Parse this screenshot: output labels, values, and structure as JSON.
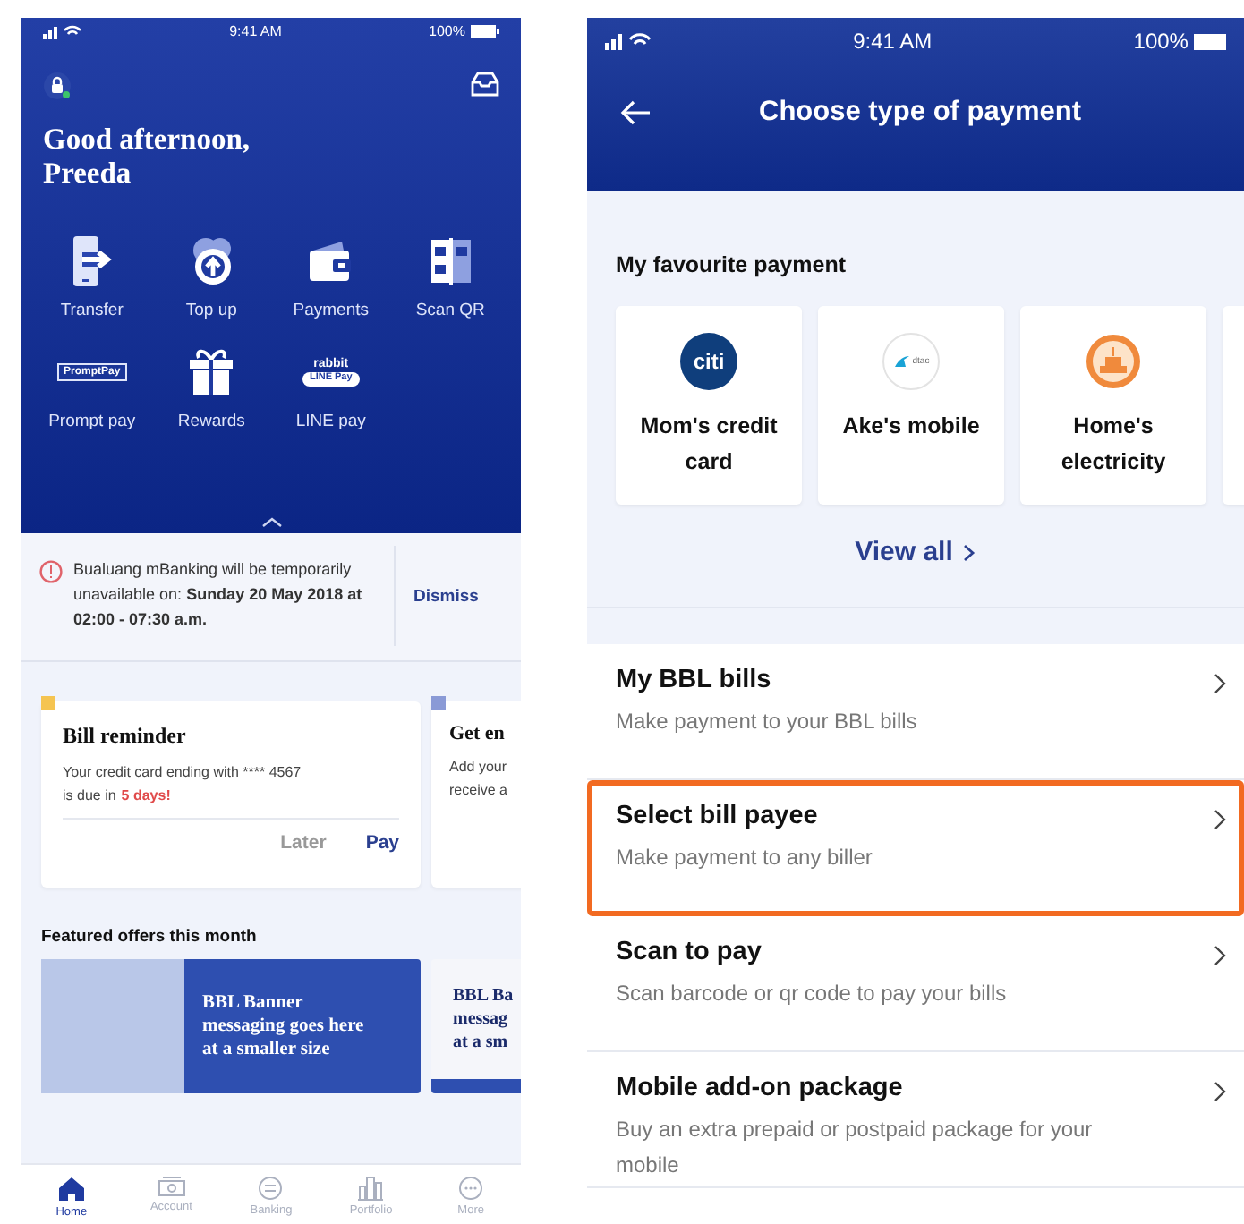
{
  "home_screen": {
    "status_bar": {
      "time": "9:41 AM",
      "battery": "100%"
    },
    "greeting": "Good afternoon, Preeda",
    "shortcuts": [
      {
        "kind": "transfer",
        "label": "Transfer"
      },
      {
        "kind": "topup",
        "label": "Top up"
      },
      {
        "kind": "payments",
        "label": "Payments"
      },
      {
        "kind": "scanqr",
        "label": "Scan QR"
      },
      {
        "kind": "promptpay",
        "label": "Prompt pay",
        "logo_lines": [
          "PromptPay"
        ]
      },
      {
        "kind": "rewards",
        "label": "Rewards"
      },
      {
        "kind": "linepay",
        "label": "LINE pay",
        "logo_lines": [
          "rabbit",
          "LINE Pay"
        ]
      }
    ],
    "notice": {
      "message": "Bualuang mBanking will be temporarily unavailable on: **Sunday 20 May 2018 at 02:00 - 07:30 a.m.**",
      "action": "Dismiss"
    },
    "cards": [
      {
        "color": "#f5c451",
        "title": "Bill reminder",
        "body": [
          "Your credit card ending with **** 4567",
          "is due in"
        ],
        "highlight": "5 days!",
        "actions": [
          {
            "label": "Later",
            "primary": false
          },
          {
            "label": "Pay",
            "primary": true
          }
        ]
      },
      {
        "color": "#8a9ad6",
        "title": "Get en",
        "body": [
          "Add your",
          "receive a"
        ]
      }
    ],
    "featured": {
      "title": "Featured offers this month",
      "banners": [
        {
          "kind": "photo",
          "lines": [
            "BBL Banner",
            "messaging goes here",
            "at a smaller size"
          ]
        },
        {
          "kind": "plain",
          "lines": [
            "BBL Ba",
            "messag",
            "at a sm"
          ]
        }
      ]
    },
    "tab_bar": [
      {
        "kind": "home",
        "label": "Home",
        "selected": true
      },
      {
        "kind": "account",
        "label": "Account",
        "selected": false
      },
      {
        "kind": "banking",
        "label": "Banking",
        "selected": false
      },
      {
        "kind": "portfolio",
        "label": "Portfolio",
        "selected": false
      },
      {
        "kind": "more",
        "label": "More",
        "selected": false
      }
    ]
  },
  "payment_screen": {
    "status_bar": {
      "time": "9:41 AM",
      "battery": "100%"
    },
    "title": "Choose type of payment",
    "favourites": {
      "title": "My favourite payment",
      "items": [
        {
          "kind": "bank",
          "logo_text": "citi",
          "label": "Mom's credit card"
        },
        {
          "kind": "mobile",
          "logo_text": "dtac",
          "label": "Ake's mobile"
        },
        {
          "kind": "utility",
          "label": "Home's electricity"
        }
      ],
      "view_all": "View all"
    },
    "options": [
      {
        "title": "My BBL bills",
        "subtitle": "Make payment to your BBL bills",
        "highlighted": false
      },
      {
        "title": "Select bill payee",
        "subtitle": "Make payment to any biller",
        "highlighted": true
      },
      {
        "title": "Scan to pay",
        "subtitle": "Scan barcode or qr code to pay your bills",
        "highlighted": false
      },
      {
        "title": "Mobile add-on package",
        "subtitle": "Buy an extra prepaid or postpaid package for your  mobile",
        "highlighted": false
      }
    ]
  }
}
